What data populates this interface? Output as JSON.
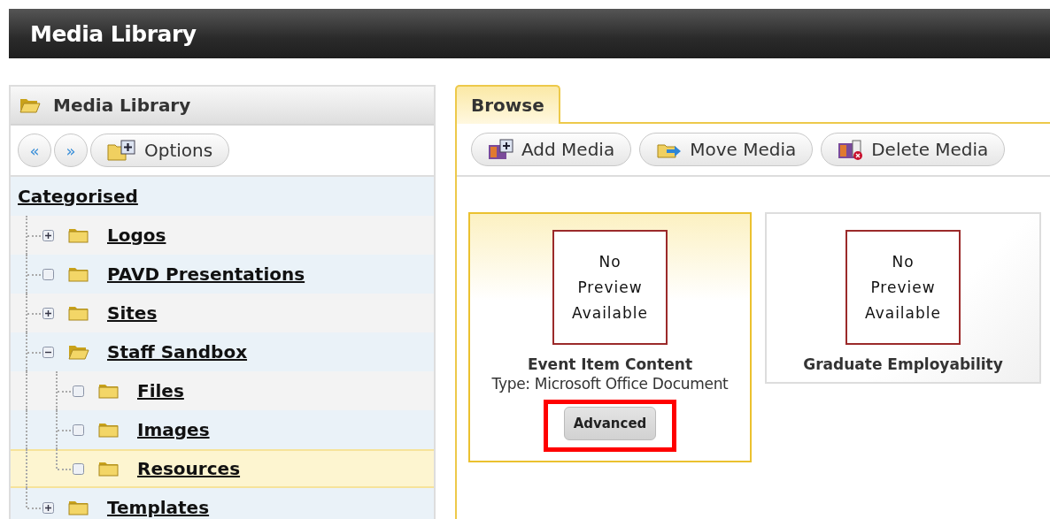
{
  "window": {
    "title": "Media Library"
  },
  "sidebar": {
    "title": "Media Library",
    "toolbar": [
      {
        "kind": "back",
        "label": "«"
      },
      {
        "kind": "forward",
        "label": "»"
      },
      {
        "kind": "options",
        "label": "Options"
      }
    ],
    "tree": {
      "root": "Categorised",
      "items": [
        {
          "label": "Logos",
          "kind": "branch",
          "expanded": false,
          "selected": false
        },
        {
          "label": "PAVD Presentations",
          "kind": "leaf",
          "selected": false
        },
        {
          "label": "Sites",
          "kind": "branch",
          "expanded": false,
          "selected": false
        },
        {
          "label": "Staff Sandbox",
          "kind": "branch",
          "expanded": true,
          "selected": false,
          "children": [
            {
              "label": "Files",
              "kind": "leaf",
              "selected": false
            },
            {
              "label": "Images",
              "kind": "leaf",
              "selected": false
            },
            {
              "label": "Resources",
              "kind": "leaf",
              "selected": true
            }
          ]
        },
        {
          "label": "Templates",
          "kind": "branch",
          "expanded": false,
          "selected": false
        }
      ]
    }
  },
  "browser": {
    "tabs": [
      {
        "label": "Browse",
        "selected": true
      }
    ],
    "actions": [
      {
        "kind": "add",
        "label": "Add Media"
      },
      {
        "kind": "move",
        "label": "Move Media"
      },
      {
        "kind": "delete",
        "label": "Delete Media"
      }
    ],
    "items": [
      {
        "preview": "No Preview Available",
        "title": "Event Item Content",
        "type": "Type: Microsoft Office Document",
        "selected": true,
        "button": {
          "label": "Advanced",
          "highlighted": true
        }
      },
      {
        "preview": "No Preview Available",
        "title": "Graduate Employability",
        "selected": false
      }
    ]
  }
}
